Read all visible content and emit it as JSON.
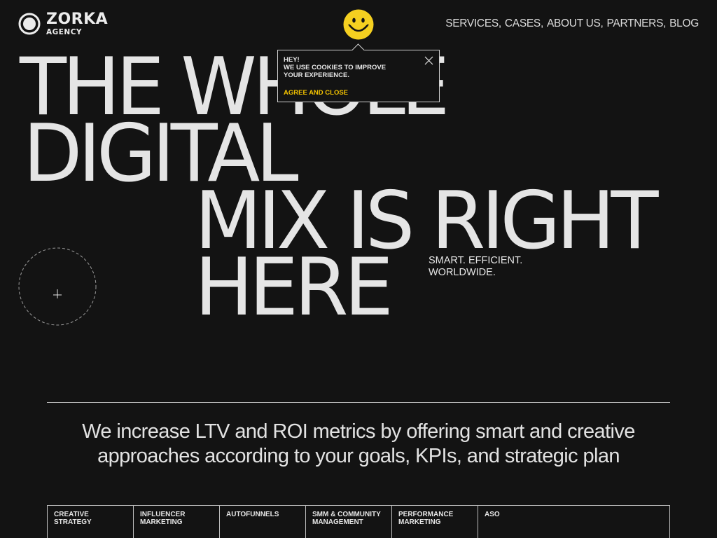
{
  "brand": {
    "name": "ZORKA",
    "sub": "AGENCY"
  },
  "nav": {
    "items": [
      {
        "label": "SERVICES,"
      },
      {
        "label": "CASES,"
      },
      {
        "label": "ABOUT US,"
      },
      {
        "label": "PARTNERS,"
      },
      {
        "label": "BLOG"
      }
    ]
  },
  "hero": {
    "line1": "THE WHOLE",
    "line2": "DIGITAL",
    "line3": "MIX IS RIGHT",
    "line4": "HERE",
    "tagline_1": "SMART. EFFICIENT.",
    "tagline_2": "WORLDWIDE."
  },
  "cookie": {
    "line1": "HEY!",
    "line2": "WE USE COOKIES TO IMPROVE",
    "line3": "YOUR EXPERIENCE.",
    "agree": "AGREE AND CLOSE"
  },
  "statement": {
    "text": "We increase LTV and ROI metrics by offering smart and creative approaches according to your goals, KPIs, and strategic plan"
  },
  "services": [
    {
      "line1": "CREATIVE",
      "line2": "STRATEGY"
    },
    {
      "line1": "INFLUENCER",
      "line2": "MARKETING"
    },
    {
      "line1": "AUTOFUNNELS",
      "line2": ""
    },
    {
      "line1": "SMM & COMMUNITY",
      "line2": "MANAGEMENT"
    },
    {
      "line1": "PERFORMANCE",
      "line2": "MARKETING"
    },
    {
      "line1": "ASO",
      "line2": ""
    }
  ],
  "icons": {
    "logo": "zorka-logo-icon",
    "smiley": "smiley-face-icon",
    "close": "close-icon",
    "cursor": "crosshair-icon"
  },
  "colors": {
    "background": "#131313",
    "text": "#e6e6e6",
    "accent": "#f2c200",
    "smiley": "#f5d020"
  }
}
